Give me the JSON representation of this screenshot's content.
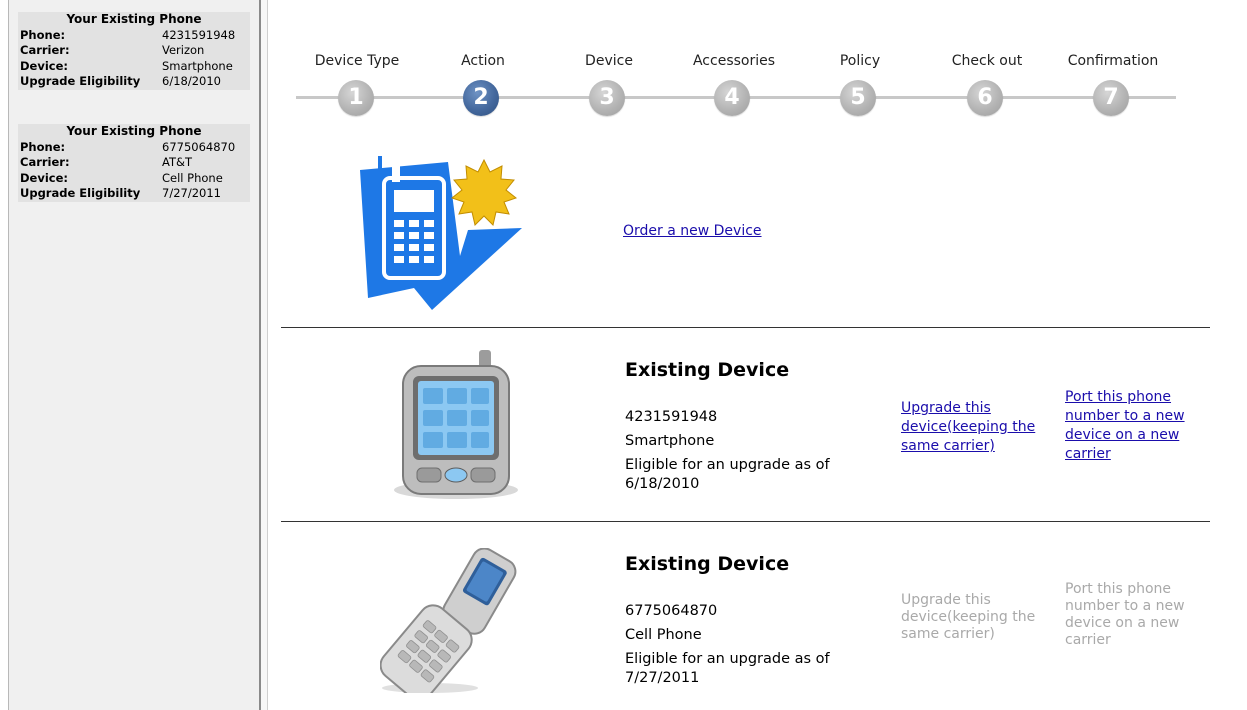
{
  "sidebar": {
    "cards": [
      {
        "title": "Your Existing Phone",
        "rows": [
          {
            "key": "Phone:",
            "value": "4231591948"
          },
          {
            "key": "Carrier:",
            "value": "Verizon"
          },
          {
            "key": "Device:",
            "value": "Smartphone"
          },
          {
            "key": "Upgrade Eligibility",
            "value": "6/18/2010"
          }
        ]
      },
      {
        "title": "Your Existing Phone",
        "rows": [
          {
            "key": "Phone:",
            "value": "6775064870"
          },
          {
            "key": "Carrier:",
            "value": "AT&T"
          },
          {
            "key": "Device:",
            "value": "Cell Phone"
          },
          {
            "key": "Upgrade Eligibility",
            "value": "7/27/2011"
          }
        ]
      }
    ]
  },
  "steps": [
    {
      "label": "Device Type",
      "number": "1"
    },
    {
      "label": "Action",
      "number": "2"
    },
    {
      "label": "Device",
      "number": "3"
    },
    {
      "label": "Accessories",
      "number": "4"
    },
    {
      "label": "Policy",
      "number": "5"
    },
    {
      "label": "Check out",
      "number": "6"
    },
    {
      "label": "Confirmation",
      "number": "7"
    }
  ],
  "active_step": "2",
  "order_new": {
    "link": "Order a new Device"
  },
  "devices": [
    {
      "heading": "Existing Device",
      "phone": "4231591948",
      "type": "Smartphone",
      "eligibility_line1": "Eligible for an upgrade as of",
      "eligibility_date": "6/18/2010",
      "upgrade_link": [
        "Upgrade this",
        "device(keeping the",
        "same carrier)"
      ],
      "port_link": [
        "Port this phone",
        "number to a new",
        "device on a new",
        "carrier"
      ],
      "enabled": true
    },
    {
      "heading": "Existing Device",
      "phone": "6775064870",
      "type": "Cell Phone",
      "eligibility_line1": "Eligible for an upgrade as of",
      "eligibility_date": "7/27/2011",
      "upgrade_link": [
        "Upgrade this",
        "device(keeping the",
        "same carrier)"
      ],
      "port_link": [
        "Port this phone",
        "number to a new",
        "device on a new",
        "carrier"
      ],
      "enabled": false
    }
  ],
  "colors": {
    "link": "#1a0dab",
    "active_step": "#44689d",
    "inactive_step": "#b4b4b4",
    "disabled_text": "#a9a9a9"
  },
  "icons": [
    "new-device-icon",
    "smartphone-icon",
    "flip-phone-icon"
  ]
}
